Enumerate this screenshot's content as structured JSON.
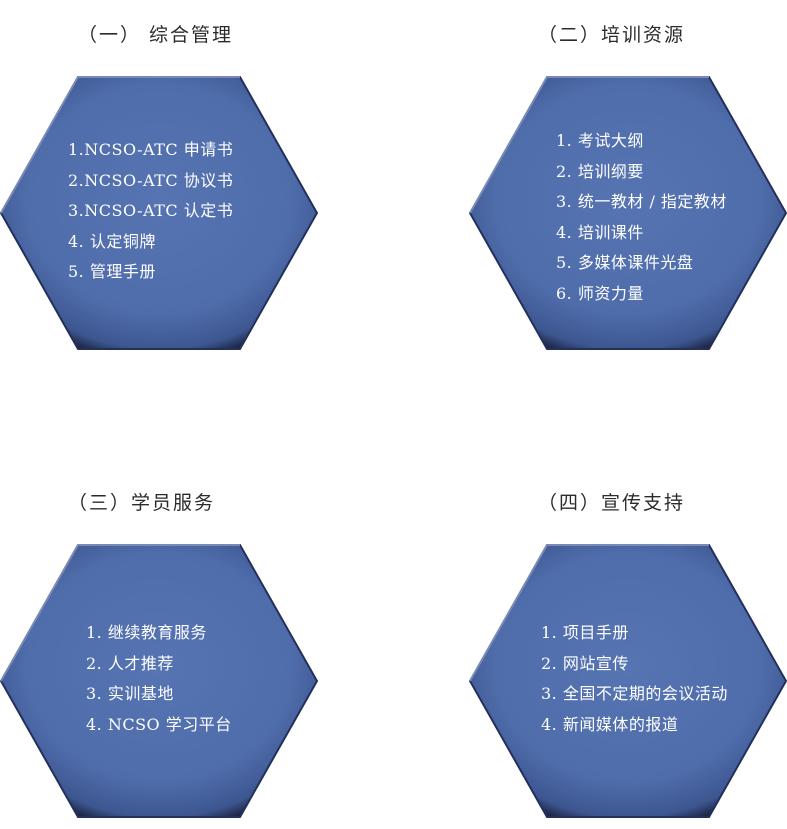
{
  "colors": {
    "hex_fill": "#5070ae",
    "hex_edge_dark": "#1a2240",
    "hex_edge_light": "#9fb6e6",
    "text": "#ffffff",
    "title": "#2b2b2b"
  },
  "sections": [
    {
      "title": "（一）  综合管理",
      "items": [
        "1.NCSO-ATC 申请书",
        "2.NCSO-ATC 协议书",
        "3.NCSO-ATC 认定书",
        "4. 认定铜牌",
        "5. 管理手册"
      ]
    },
    {
      "title": "（二）培训资源",
      "items": [
        "1. 考试大纲",
        "2. 培训纲要",
        "3. 统一教材 / 指定教材",
        "4. 培训课件",
        "5. 多媒体课件光盘",
        "6. 师资力量"
      ]
    },
    {
      "title": "（三）学员服务",
      "items": [
        "1.  继续教育服务",
        "2.  人才推荐",
        "3.  实训基地",
        "4.  NCSO 学习平台"
      ]
    },
    {
      "title": "（四）宣传支持",
      "items": [
        "1. 项目手册",
        "2. 网站宣传",
        "3. 全国不定期的会议活动",
        "4. 新闻媒体的报道"
      ]
    }
  ]
}
